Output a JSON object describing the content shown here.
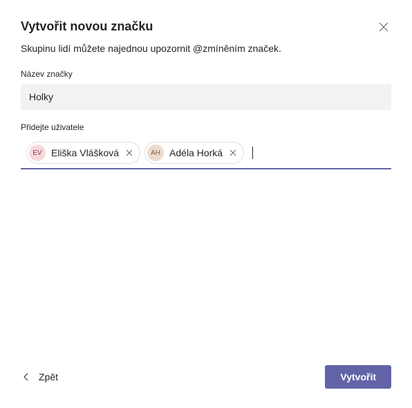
{
  "dialog": {
    "title": "Vytvořit novou značku",
    "subtitle": "Skupinu lidí můžete najednou upozornit @zmíněním značek."
  },
  "tagName": {
    "label": "Název značky",
    "value": "Holky"
  },
  "people": {
    "label": "Přidejte uživatele",
    "chips": [
      {
        "initials": "EV",
        "name": "Eliška Vlášková"
      },
      {
        "initials": "AH",
        "name": "Adéla Horká"
      }
    ]
  },
  "footer": {
    "back": "Zpět",
    "create": "Vytvořit"
  }
}
